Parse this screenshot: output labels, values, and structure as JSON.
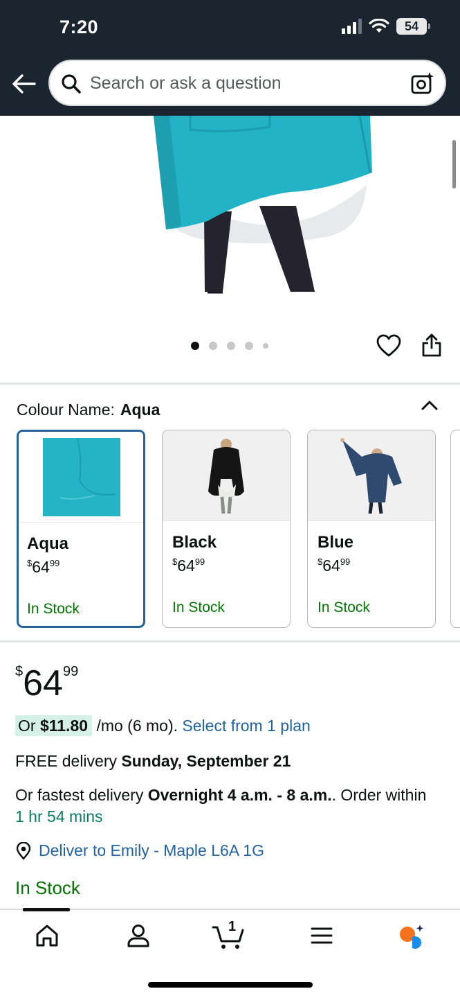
{
  "status_bar": {
    "time": "7:20",
    "battery": "54"
  },
  "header": {
    "search_placeholder": "Search or ask a question"
  },
  "colours": {
    "label": "Colour Name:",
    "selected": "Aqua",
    "options": [
      {
        "name": "Aqua",
        "price_currency": "$",
        "price_whole": "64",
        "price_fraction": "99",
        "stock": "In Stock",
        "color": "#23b5c7"
      },
      {
        "name": "Black",
        "price_currency": "$",
        "price_whole": "64",
        "price_fraction": "99",
        "stock": "In Stock",
        "color": "#111111"
      },
      {
        "name": "Blue",
        "price_currency": "$",
        "price_whole": "64",
        "price_fraction": "99",
        "stock": "In Stock",
        "color": "#2f4a6e"
      }
    ]
  },
  "pricing": {
    "currency": "$",
    "whole": "64",
    "fraction": "99",
    "monthly_prefix": "Or",
    "monthly_amount": "$11.80",
    "monthly_suffix": "/mo (6 mo).",
    "plan_link": "Select from 1 plan"
  },
  "delivery": {
    "free_prefix": "FREE delivery",
    "free_date": "Sunday, September 21",
    "fast_prefix": "Or fastest delivery",
    "fast_window": "Overnight 4 a.m. - 8 a.m.",
    "fast_mid": ". Order within",
    "countdown": "1 hr 54 mins",
    "deliver_to": "Deliver to Emily - Maple L6A 1G"
  },
  "availability": "In Stock",
  "colors": {
    "header_bg": "#1b2530",
    "link": "#2162a1",
    "stock_green": "#007600",
    "selected_border": "#2162a1"
  },
  "bottom_nav": [
    "home-icon",
    "account-icon",
    "cart-icon",
    "menu-icon",
    "rufus-icon"
  ],
  "cart_count": "1"
}
